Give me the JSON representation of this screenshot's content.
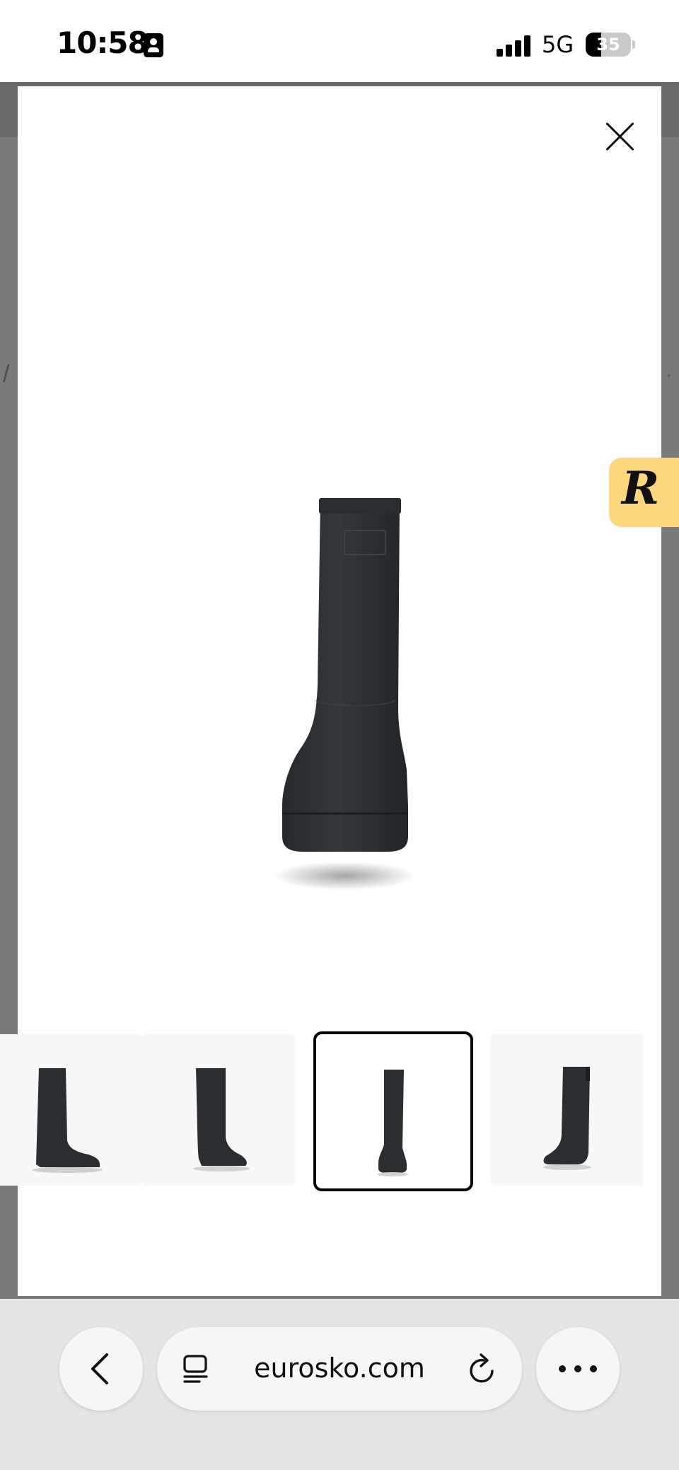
{
  "status_bar": {
    "time": "10:58",
    "network": "5G",
    "battery_percent": "35"
  },
  "viewer": {
    "close_icon": "close-icon",
    "thumbnails": [
      {
        "view": "side-partial"
      },
      {
        "view": "three-quarter"
      },
      {
        "view": "front",
        "selected": true
      },
      {
        "view": "back-side"
      }
    ]
  },
  "floating_badge": {
    "letter": "R"
  },
  "browser": {
    "url": "eurosko.com",
    "icons": [
      "chevron-left-icon",
      "tabs-icon",
      "reload-icon",
      "more-icon"
    ]
  },
  "colors": {
    "badge": "#fdd77e",
    "boot": "#2b2e30",
    "overlay": "#7a7a7a"
  }
}
